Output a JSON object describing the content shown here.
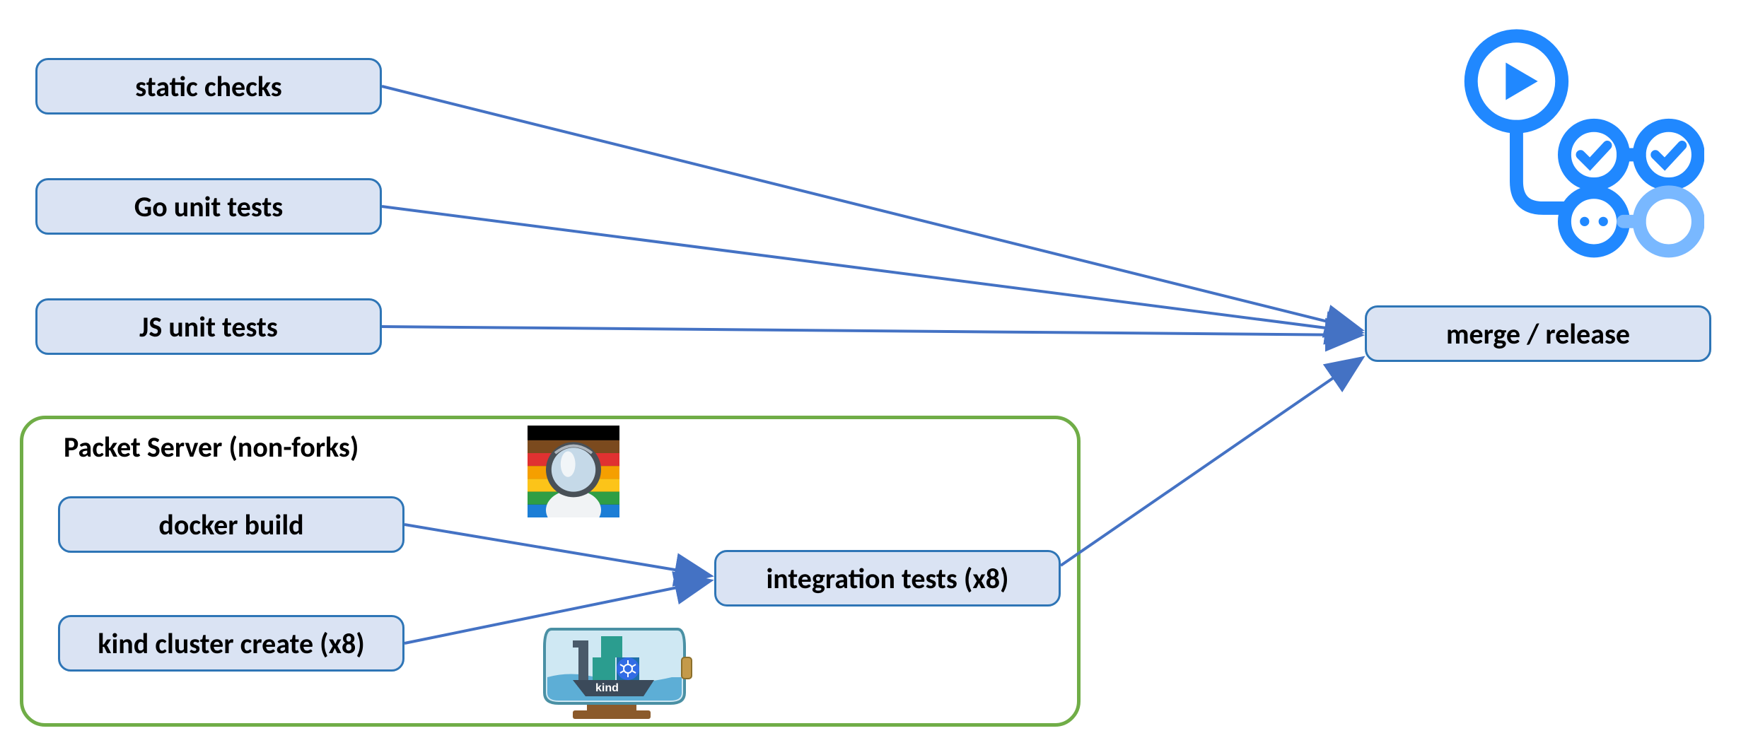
{
  "nodes": {
    "static_checks": "static checks",
    "go_unit_tests": "Go unit tests",
    "js_unit_tests": "JS unit tests",
    "docker_build": "docker build",
    "kind_cluster_create": "kind cluster create (x8)",
    "integration_tests": "integration tests (x8)",
    "merge_release": "merge / release"
  },
  "group": {
    "label": "Packet Server (non-forks)"
  },
  "icons": {
    "gha": "github-actions-icon",
    "avatar": "hubot-avatar-icon",
    "kind": "kind-logo-icon",
    "kind_text": "kind"
  },
  "colors": {
    "node_fill": "#dae3f3",
    "node_border": "#2e75b6",
    "group_border": "#70ad47",
    "arrow": "#4472c4",
    "gha_blue": "#2088FF",
    "gha_light": "#79B8FF"
  }
}
